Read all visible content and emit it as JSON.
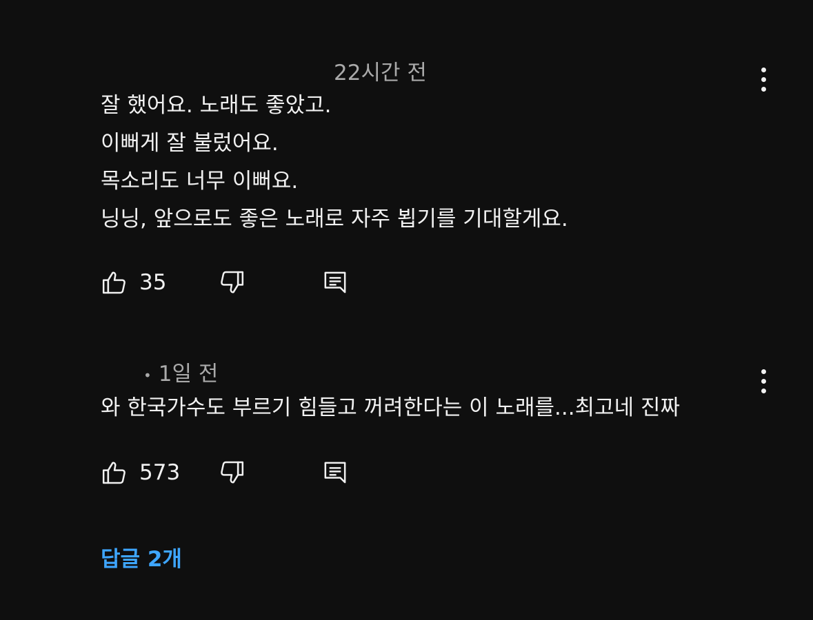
{
  "comments": [
    {
      "time": "22시간 전",
      "lines": [
        "잘 했어요. 노래도 좋았고.",
        "이뻐게 잘 불렀어요.",
        "목소리도 너무 이뻐요.",
        "닝닝,  앞으로도 좋은 노래로 자주 뵙기를 기대할게요."
      ],
      "likes": "35"
    },
    {
      "dot": "•",
      "time": "1일 전",
      "lines": [
        "와 한국가수도 부르기 힘들고 꺼려한다는 이 노래를...최고네 진짜"
      ],
      "likes": "573"
    }
  ],
  "replies_label": "답글 2개",
  "icons": {
    "like": "thumbs-up-icon",
    "dislike": "thumbs-down-icon",
    "reply": "comment-icon",
    "more": "more-vertical-icon"
  },
  "colors": {
    "background": "#0f0f0f",
    "text": "#f1f1f1",
    "secondary": "#aaaaaa",
    "link": "#3ea6ff"
  }
}
